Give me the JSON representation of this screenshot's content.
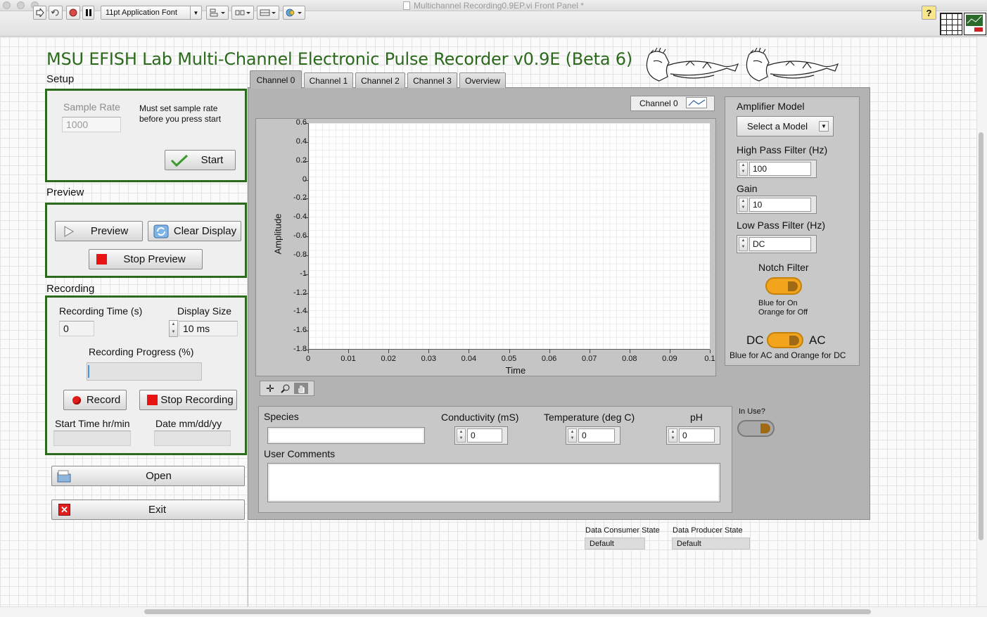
{
  "window": {
    "title": "Multichannel Recording0.9EP.vi Front Panel *"
  },
  "toolbar": {
    "font": "11pt Application Font",
    "help": "?"
  },
  "app_title": "MSU EFISH Lab Multi-Channel Electronic Pulse Recorder v0.9E (Beta 6)",
  "setup": {
    "label": "Setup",
    "sample_rate_label": "Sample Rate",
    "sample_rate_value": "1000",
    "note": "Must set sample rate before you press start",
    "start": "Start"
  },
  "preview": {
    "label": "Preview",
    "preview": "Preview",
    "clear": "Clear Display",
    "stop": "Stop Preview"
  },
  "recording": {
    "label": "Recording",
    "time_label": "Recording Time (s)",
    "time_value": "0",
    "display_size_label": "Display Size",
    "display_size_value": "10 ms",
    "progress_label": "Recording Progress (%)",
    "progress_fraction": 0,
    "record": "Record",
    "stop": "Stop Recording",
    "start_time_label": "Start Time hr/min",
    "start_time_value": "",
    "date_label": "Date mm/dd/yy",
    "date_value": ""
  },
  "open": "Open",
  "exit": "Exit",
  "tabs": [
    "Channel 0",
    "Channel 1",
    "Channel 2",
    "Channel 3",
    "Overview"
  ],
  "active_tab": "Channel 0",
  "graph": {
    "legend": "Channel 0"
  },
  "chart_data": {
    "type": "line",
    "xlabel": "Time",
    "ylabel": "Amplitude",
    "xlim": [
      0,
      0.1
    ],
    "ylim": [
      -1.8,
      0.6
    ],
    "x_ticks": [
      "0",
      "0.01",
      "0.02",
      "0.03",
      "0.04",
      "0.05",
      "0.06",
      "0.07",
      "0.08",
      "0.09",
      "0.1"
    ],
    "y_ticks": [
      "0.6",
      "0.4",
      "0.2",
      "0",
      "-0.2",
      "-0.4",
      "-0.6",
      "-0.8",
      "-1",
      "-1.2",
      "-1.4",
      "-1.6",
      "-1.8"
    ],
    "series": [],
    "grid": true
  },
  "amplifier": {
    "model_label": "Amplifier Model",
    "model_value": "Select a Model",
    "hp_label": "High Pass Filter (Hz)",
    "hp_value": "100",
    "gain_label": "Gain",
    "gain_value": "10",
    "lp_label": "Low Pass Filter (Hz)",
    "lp_value": "DC",
    "notch_label": "Notch Filter",
    "notch_note_1": "Blue for On",
    "notch_note_2": "Orange for Off",
    "dc": "DC",
    "ac": "AC",
    "coupling_note": "Blue for AC and Orange for DC"
  },
  "info": {
    "species_label": "Species",
    "species_value": "",
    "conductivity_label": "Conductivity (mS)",
    "conductivity_value": "0",
    "temperature_label": "Temperature (deg C)",
    "temperature_value": "0",
    "ph_label": "pH",
    "ph_value": "0",
    "comments_label": "User Comments",
    "comments_value": "",
    "in_use_label": "In Use?"
  },
  "states": {
    "consumer_label": "Data Consumer State",
    "consumer_value": "Default",
    "producer_label": "Data Producer State",
    "producer_value": "Default"
  },
  "colors": {
    "panel_border": "#2b6b1b",
    "title_green": "#2a6a1a",
    "toggle_orange": "#f2a51c",
    "stop_red": "#e81414"
  }
}
